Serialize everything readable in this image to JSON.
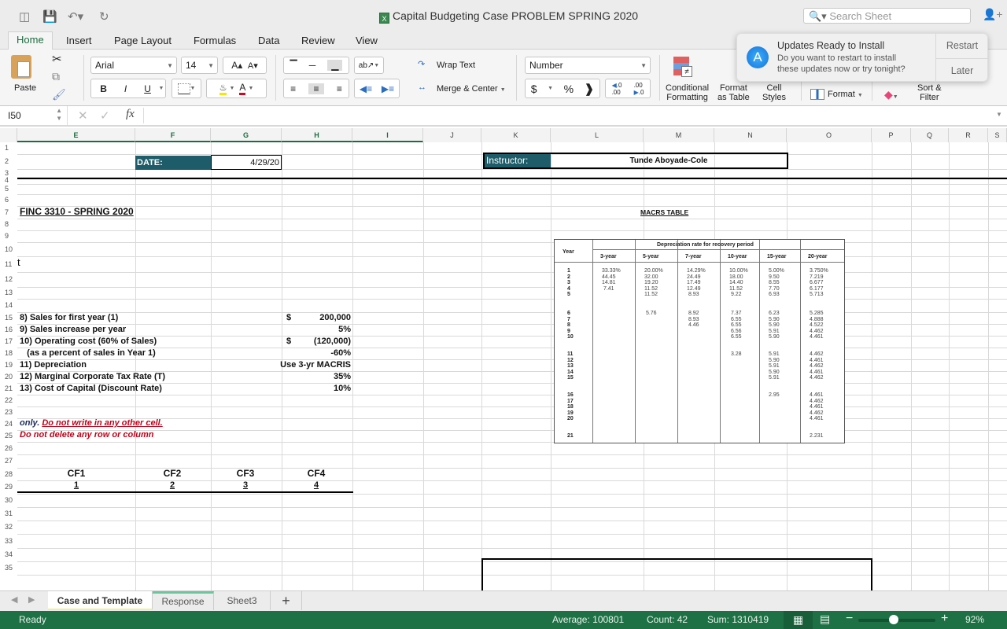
{
  "window": {
    "title": "Capital Budgeting Case PROBLEM SPRING 2020",
    "search_placeholder": "Search Sheet"
  },
  "ribbon_tabs": [
    "Home",
    "Insert",
    "Page Layout",
    "Formulas",
    "Data",
    "Review",
    "View"
  ],
  "ribbon": {
    "paste": "Paste",
    "font_name": "Arial",
    "font_size": "14",
    "bold": "B",
    "italic": "I",
    "underline": "U",
    "wrap_text": "Wrap Text",
    "merge_center": "Merge & Center",
    "number_format": "Number",
    "currency": "$",
    "percent": "%",
    "comma": ",",
    "inc_decimal": ".00",
    "dec_decimal": ".0",
    "conditional_formatting": [
      "Conditional",
      "Formatting"
    ],
    "format_as_table": [
      "Format",
      "as Table"
    ],
    "cell_styles": [
      "Cell",
      "Styles"
    ],
    "format": "Format",
    "sort_filter": [
      "Sort &",
      "Filter"
    ]
  },
  "notification": {
    "title": "Updates Ready to Install",
    "body_line1": "Do you want to restart to install",
    "body_line2": "these updates now or try tonight?",
    "restart": "Restart",
    "later": "Later"
  },
  "formula_bar": {
    "name_box": "I50",
    "fx": "fx",
    "value": ""
  },
  "columns": [
    "E",
    "F",
    "G",
    "H",
    "I",
    "J",
    "K",
    "L",
    "M",
    "N",
    "O",
    "P",
    "Q",
    "R",
    "S"
  ],
  "selected_columns": [
    "E",
    "F",
    "G",
    "H",
    "I"
  ],
  "rows": [
    "1",
    "2",
    "3",
    "4",
    "5",
    "6",
    "7",
    "8",
    "9",
    "10",
    "11",
    "12",
    "13",
    "14",
    "15",
    "16",
    "17",
    "18",
    "19",
    "20",
    "21",
    "22",
    "23",
    "24",
    "25",
    "26",
    "27",
    "28",
    "29",
    "30",
    "31",
    "32",
    "33",
    "34",
    "35"
  ],
  "sheet": {
    "date_label": "DATE:",
    "date_value": "4/29/20",
    "instructor_label": "Instructor:",
    "instructor_name": "Tunde Aboyade-Cole",
    "course": "FINC 3310 - SPRING 2020",
    "macrs_title": "MACRS TABLE",
    "row10_fragment": "t",
    "inputs": [
      {
        "label": "8) Sales for first year (1)",
        "currency": "$",
        "value": "200,000"
      },
      {
        "label": "9) Sales increase per year",
        "currency": "",
        "value": "5%"
      },
      {
        "label": "10) Operating cost (60% of Sales)",
        "currency": "$",
        "value": "(120,000)"
      },
      {
        "label": "   (as a percent of sales in Year 1)",
        "currency": "",
        "value": "-60%"
      },
      {
        "label": "11) Depreciation",
        "currency": "",
        "value": "Use 3-yr MACRIS"
      },
      {
        "label": "12) Marginal Corporate Tax Rate (T)",
        "currency": "",
        "value": "35%"
      },
      {
        "label": "13) Cost of Capital (Discount Rate)",
        "currency": "",
        "value": "10%"
      }
    ],
    "note_only": "only.",
    "note_red1": "Do not write in any other cell.",
    "note_red2": "Do not delete any row or column",
    "cf_headers": [
      "CF1",
      "CF2",
      "CF3",
      "CF4"
    ],
    "cf_numbers": [
      "1",
      "2",
      "3",
      "4"
    ]
  },
  "macrs_table": {
    "year_header": "Year",
    "group_header": "Depreciation rate for recovery period",
    "periods": [
      "3-year",
      "5-year",
      "7-year",
      "10-year",
      "15-year",
      "20-year"
    ],
    "year_blocks": [
      "1\n2\n3\n4\n5",
      "6\n7\n8\n9\n10",
      "11\n12\n13\n14\n15",
      "16\n17\n18\n19\n20",
      "21"
    ],
    "columns": [
      [
        "33.33%\n44.45\n14.81\n 7.41",
        "",
        "",
        "",
        ""
      ],
      [
        "20.00%\n32.00\n19.20\n11.52\n11.52",
        " 5.76",
        "",
        "",
        ""
      ],
      [
        "14.29%\n24.49\n17.49\n12.49\n 8.93",
        " 8.92\n 8.93\n 4.46",
        "",
        "",
        ""
      ],
      [
        "10.00%\n18.00\n14.40\n11.52\n 9.22",
        " 7.37\n 6.55\n 6.55\n 6.56\n 6.55",
        " 3.28",
        "",
        ""
      ],
      [
        "5.00%\n9.50\n8.55\n7.70\n6.93",
        "6.23\n5.90\n5.90\n5.91\n5.90",
        "5.91\n5.90\n5.91\n5.90\n5.91",
        "2.95",
        ""
      ],
      [
        "3.750%\n7.219\n6.677\n6.177\n5.713",
        "5.285\n4.888\n4.522\n4.462\n4.461",
        "4.462\n4.461\n4.462\n4.461\n4.462",
        "4.461\n4.462\n4.461\n4.462\n4.461",
        "2.231"
      ]
    ]
  },
  "sheet_tabs": [
    "Case and Template",
    "Response",
    "Sheet3"
  ],
  "active_sheet": "Case and Template",
  "status_bar": {
    "mode": "Ready",
    "average": "Average: 100801",
    "count": "Count: 42",
    "sum": "Sum: 1310419",
    "zoom": "92%",
    "zoom_level": 0.92
  }
}
